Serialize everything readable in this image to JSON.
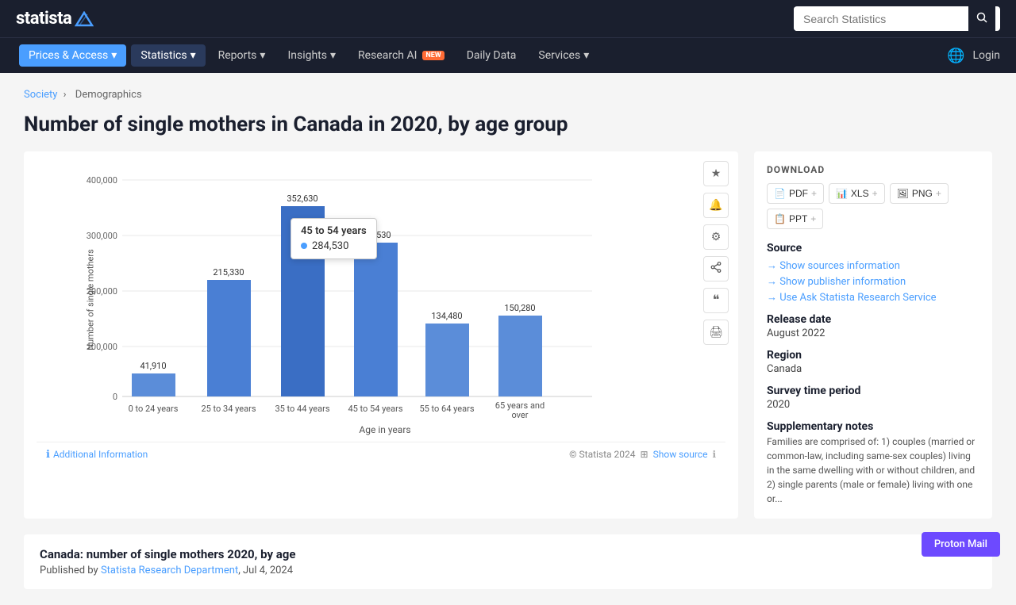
{
  "header": {
    "logo": "statista",
    "search_placeholder": "Search Statistics"
  },
  "nav": {
    "items": [
      {
        "id": "prices-access",
        "label": "Prices & Access",
        "active": true,
        "dropdown": true
      },
      {
        "id": "statistics",
        "label": "Statistics",
        "dropdown": true,
        "style": "stats"
      },
      {
        "id": "reports",
        "label": "Reports",
        "dropdown": true
      },
      {
        "id": "insights",
        "label": "Insights",
        "dropdown": true
      },
      {
        "id": "research-ai",
        "label": "Research AI",
        "badge": "NEW",
        "dropdown": false
      },
      {
        "id": "daily-data",
        "label": "Daily Data",
        "dropdown": false
      },
      {
        "id": "services",
        "label": "Services",
        "dropdown": true
      }
    ],
    "login": "Login"
  },
  "breadcrumb": {
    "items": [
      "Society",
      "Demographics"
    ]
  },
  "page": {
    "title": "Number of single mothers in Canada in 2020, by age group"
  },
  "chart": {
    "y_axis_label": "Number of single mothers",
    "x_axis_label": "Age in years",
    "y_ticks": [
      "400,000",
      "300,000",
      "200,000",
      "100,000",
      "0"
    ],
    "bars": [
      {
        "label": "0 to 24 years",
        "value": 41910,
        "display": "41,910",
        "height_pct": 10.5
      },
      {
        "label": "25 to 34 years",
        "value": 215330,
        "display": "215,330",
        "height_pct": 53.8
      },
      {
        "label": "35 to 44 years",
        "value": 352630,
        "display": "352,630",
        "height_pct": 88.2
      },
      {
        "label": "45 to 54 years",
        "value": 284530,
        "display": "284,530",
        "height_pct": 71.1
      },
      {
        "label": "55 to 64 years",
        "value": 134480,
        "display": "134,480",
        "height_pct": 33.6
      },
      {
        "label": "65 years and over",
        "value": 150280,
        "display": "150,280",
        "height_pct": 37.6
      }
    ],
    "tooltip": {
      "age_group": "45 to 54 years",
      "value": "284,530"
    },
    "copyright": "© Statista 2024",
    "additional_info": "Additional Information",
    "show_source": "Show source"
  },
  "download": {
    "title": "DOWNLOAD",
    "buttons": [
      {
        "id": "pdf",
        "label": "PDF",
        "icon": "📄"
      },
      {
        "id": "xls",
        "label": "XLS",
        "icon": "📊"
      },
      {
        "id": "png",
        "label": "PNG",
        "icon": "🖼"
      },
      {
        "id": "ppt",
        "label": "PPT",
        "icon": "📋"
      }
    ]
  },
  "sidebar": {
    "source_title": "Source",
    "source_links": [
      "Show sources information",
      "Show publisher information",
      "Use Ask Statista Research Service"
    ],
    "release_date_label": "Release date",
    "release_date_value": "August 2022",
    "region_label": "Region",
    "region_value": "Canada",
    "survey_period_label": "Survey time period",
    "survey_period_value": "2020",
    "supp_notes_label": "Supplementary notes",
    "supp_notes_text": "Families are comprised of: 1) couples (married or common-law, including same-sex couples) living in the same dwelling with or without children, and 2) single parents (male or female) living with one or..."
  },
  "bottom": {
    "title": "Canada: number of single mothers 2020, by age",
    "published_by": "Published by",
    "author": "Statista Research Department",
    "date": "Jul 4, 2024"
  },
  "proton_mail": {
    "label": "Proton Mail"
  },
  "icons": {
    "star": "★",
    "bell": "🔔",
    "gear": "⚙",
    "share": "↗",
    "quote": "❝",
    "print": "🖨",
    "search": "🔍",
    "info": "ℹ",
    "globe": "🌐",
    "chevron_down": "▾"
  }
}
